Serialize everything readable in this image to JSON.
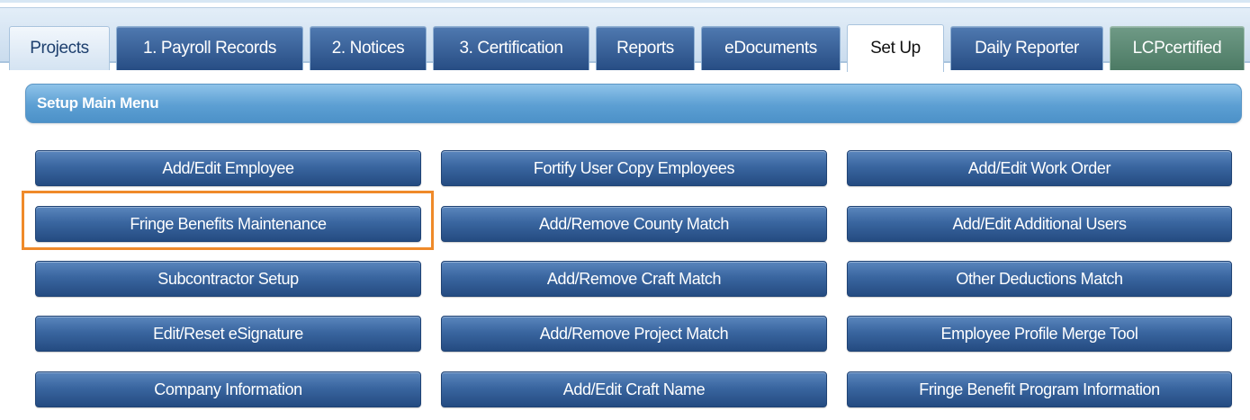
{
  "tabs": [
    {
      "label": "Projects",
      "state": "light"
    },
    {
      "label": "1. Payroll Records",
      "state": "normal"
    },
    {
      "label": "2. Notices",
      "state": "normal"
    },
    {
      "label": "3. Certification",
      "state": "normal"
    },
    {
      "label": "Reports",
      "state": "normal"
    },
    {
      "label": "eDocuments",
      "state": "normal"
    },
    {
      "label": "Set Up",
      "state": "active"
    },
    {
      "label": "Daily Reporter",
      "state": "normal"
    },
    {
      "label": "LCPcertified",
      "state": "green"
    }
  ],
  "panel": {
    "title": "Setup Main Menu"
  },
  "buttons": {
    "col1": [
      "Add/Edit Employee",
      "Fringe Benefits Maintenance",
      "Subcontractor Setup",
      "Edit/Reset eSignature",
      "Company Information"
    ],
    "col2": [
      "Fortify User Copy Employees",
      "Add/Remove County Match",
      "Add/Remove Craft Match",
      "Add/Remove Project Match",
      "Add/Edit Craft Name"
    ],
    "col3": [
      "Add/Edit Work Order",
      "Add/Edit Additional Users",
      "Other Deductions Match",
      "Employee Profile Merge Tool",
      "Fringe Benefit Program Information"
    ]
  },
  "colors": {
    "highlight_outline": "#ef8a2a",
    "button_blue": "#3a66a0",
    "header_blue": "#5c9fd3",
    "tab_green": "#5d8a74"
  }
}
